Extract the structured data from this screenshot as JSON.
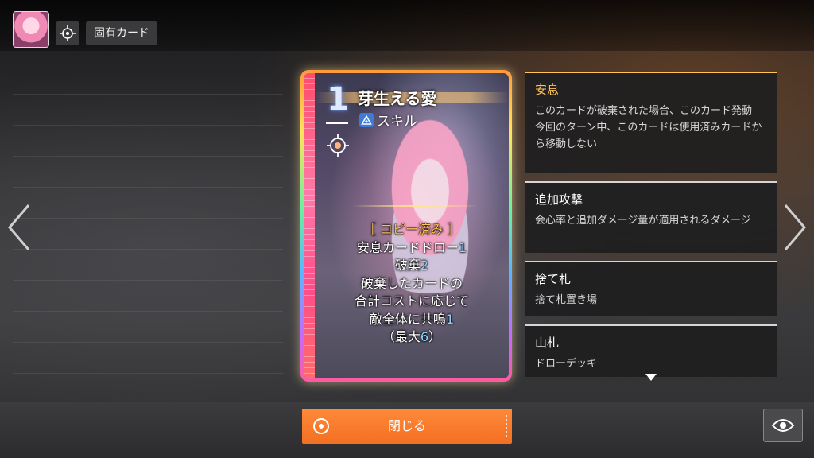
{
  "header": {
    "character_avatar": "character-portrait",
    "focus_icon": "target-icon",
    "tag_label": "固有カード"
  },
  "card": {
    "cost": "1",
    "title": "芽生える愛",
    "type_label": "スキル",
    "type_icon": "triangle-skill-icon",
    "status_label": "［ コピー済み ］",
    "effect_lines": [
      {
        "text": "安息カードドロー",
        "num": "1"
      },
      {
        "text": "破棄",
        "num": "2"
      },
      {
        "text": "破棄したカードの",
        "num": ""
      },
      {
        "text": "合計コストに応じて",
        "num": ""
      },
      {
        "text": "敵全体に共鳴",
        "num": "1"
      },
      {
        "text": "（最大",
        "num": "6",
        "suffix": "）"
      }
    ],
    "colors": {
      "rail": "#ff4d6d",
      "cost_glow": "#6aa6ff",
      "status": "#ffc35a",
      "number": "#8fd4ff"
    }
  },
  "keywords": [
    {
      "title": "安息",
      "desc": "このカードが破棄された場合、このカード発動\n今回のターン中、このカードは使用済みカードから移動しない",
      "highlight": true
    },
    {
      "title": "追加攻撃",
      "desc": "会心率と追加ダメージ量が適用されるダメージ",
      "highlight": false
    },
    {
      "title": "捨て札",
      "desc": "捨て札置き場",
      "highlight": false
    },
    {
      "title": "山札",
      "desc": "ドローデッキ",
      "highlight": false
    }
  ],
  "footer": {
    "close_label": "閉じる",
    "close_color": "#f36f22",
    "eye_icon": "eye-icon"
  },
  "nav": {
    "prev_icon": "chevron-left-icon",
    "next_icon": "chevron-right-icon"
  }
}
